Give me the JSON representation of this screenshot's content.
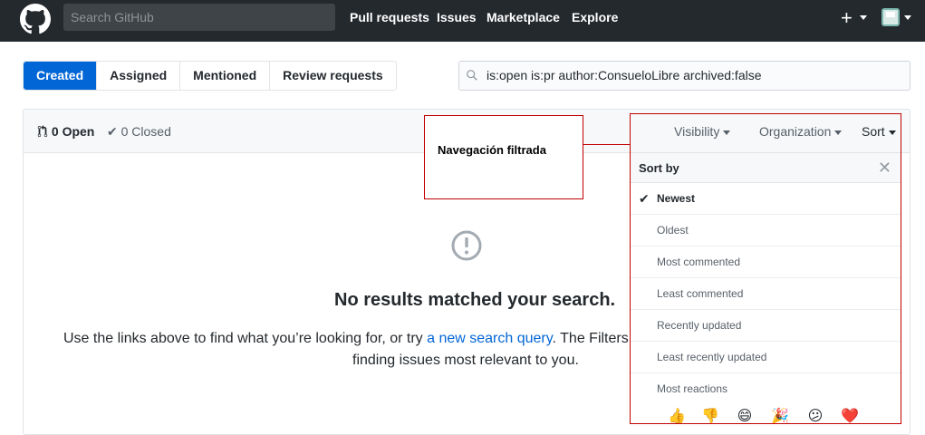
{
  "header": {
    "search_placeholder": "Search GitHub",
    "nav": [
      "Pull requests",
      "Issues",
      "Marketplace",
      "Explore"
    ],
    "plus_icon": "plus-icon",
    "avatar_icon": "user-avatar"
  },
  "tabs": [
    "Created",
    "Assigned",
    "Mentioned",
    "Review requests"
  ],
  "query": "is:open is:pr author:ConsueloLibre archived:false",
  "states": {
    "open": "0 Open",
    "closed": "0 Closed"
  },
  "filters": {
    "visibility": "Visibility",
    "organization": "Organization",
    "sort": "Sort"
  },
  "blankslate": {
    "title": "No results matched your search.",
    "line1_pre": "Use the links above to find what you’re looking for, or try ",
    "line1_link": "a new search query",
    "line1_post": ". The Filters",
    "line2": "finding issues most relevant to you."
  },
  "callout": "Navegación filtrada",
  "sort_menu": {
    "title": "Sort by",
    "items": [
      "Newest",
      "Oldest",
      "Most commented",
      "Least commented",
      "Recently updated",
      "Least recently updated",
      "Most reactions"
    ],
    "selected": "Newest",
    "reactions": [
      "👍",
      "👎",
      "😄",
      "🎉",
      "😕",
      "❤️"
    ]
  },
  "colors": {
    "accent": "#0366d6",
    "header_bg": "#24292e",
    "callout_border": "#c00000"
  }
}
